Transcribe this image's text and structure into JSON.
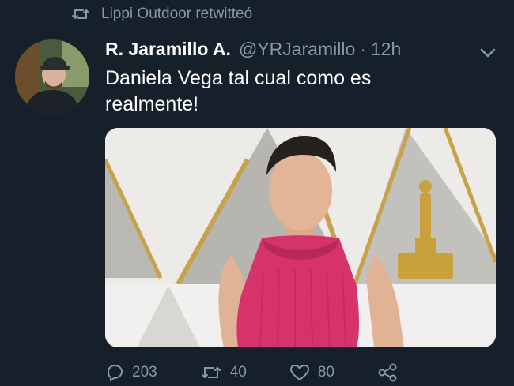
{
  "retweet": {
    "icon": "retweet-icon",
    "text": "Lippi Outdoor retwitteó"
  },
  "tweet": {
    "avatar": "profile-photo",
    "display_name": "R. Jaramillo A.",
    "handle": "@YRJaramillo",
    "separator": "·",
    "time": "12h",
    "menu_icon": "chevron-down-icon",
    "text": "Daniela Vega tal cual como es realmente!",
    "media": "photo-person-pink-dress-red-carpet",
    "actions": {
      "reply": {
        "icon": "reply-icon",
        "count": "203"
      },
      "retweet": {
        "icon": "retweet-icon",
        "count": "40"
      },
      "like": {
        "icon": "heart-icon",
        "count": "80"
      },
      "share": {
        "icon": "share-icon"
      }
    }
  },
  "colors": {
    "background": "#15202b",
    "text": "#ffffff",
    "secondary": "#8899a6",
    "dress": "#d6336c"
  }
}
